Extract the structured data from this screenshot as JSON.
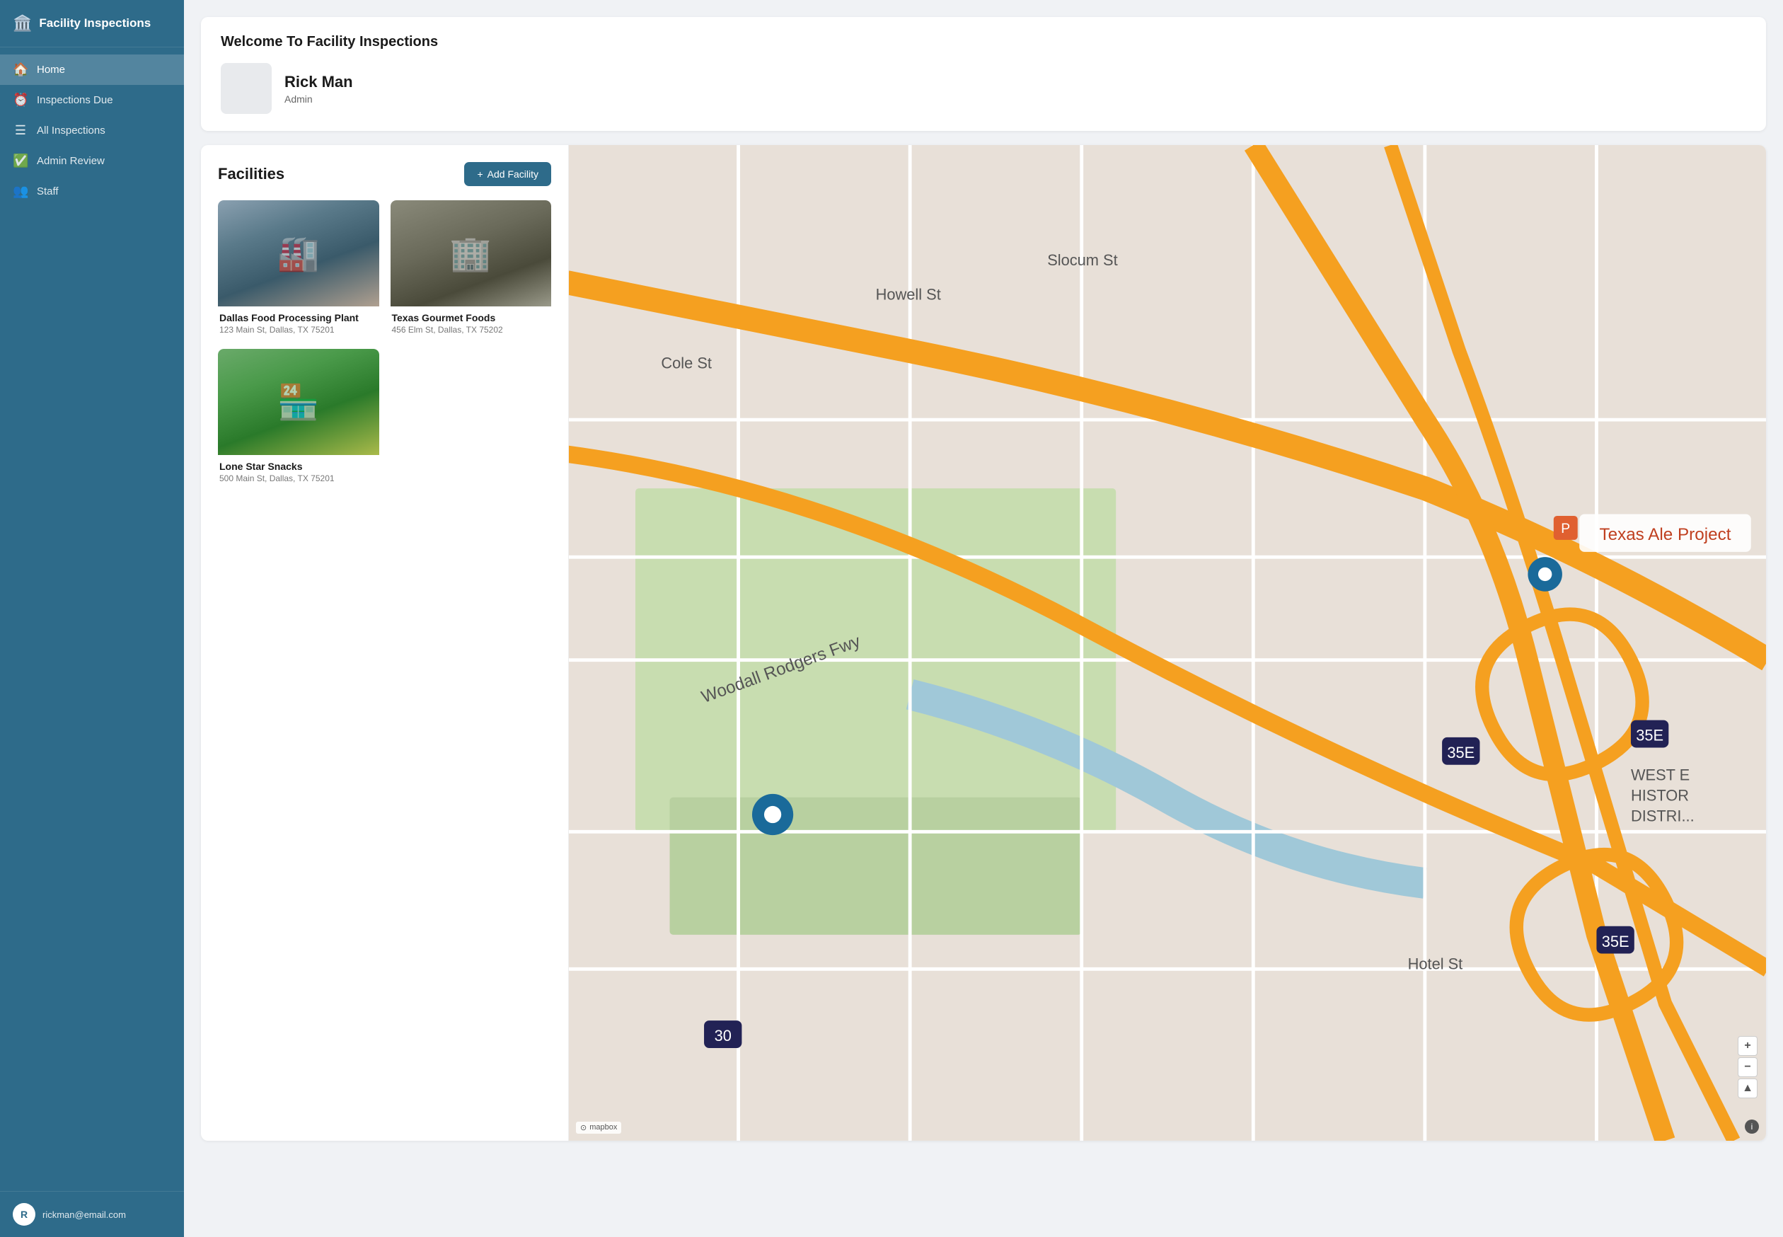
{
  "app": {
    "title": "Facility Inspections",
    "title_icon": "🏛️"
  },
  "sidebar": {
    "nav_items": [
      {
        "id": "home",
        "label": "Home",
        "icon": "home",
        "active": true
      },
      {
        "id": "inspections-due",
        "label": "Inspections Due",
        "icon": "clock",
        "active": false
      },
      {
        "id": "all-inspections",
        "label": "All Inspections",
        "icon": "list",
        "active": false
      },
      {
        "id": "admin-review",
        "label": "Admin Review",
        "icon": "check-circle",
        "active": false
      },
      {
        "id": "staff",
        "label": "Staff",
        "icon": "users",
        "active": false
      }
    ],
    "user": {
      "initial": "R",
      "email": "rickman@email.com"
    }
  },
  "welcome": {
    "title": "Welcome To Facility Inspections",
    "user_name": "Rick Man",
    "user_role": "Admin"
  },
  "facilities": {
    "section_title": "Facilities",
    "add_button_label": "Add Facility",
    "add_button_icon": "+",
    "items": [
      {
        "id": "dallas-food",
        "name": "Dallas Food Processing Plant",
        "address": "123 Main St, Dallas, TX 75201",
        "img_type": "dallas"
      },
      {
        "id": "texas-gourmet",
        "name": "Texas Gourmet Foods",
        "address": "456 Elm St, Dallas, TX 75202",
        "img_type": "texas"
      },
      {
        "id": "lone-star",
        "name": "Lone Star Snacks",
        "address": "500 Main St, Dallas, TX 75201",
        "img_type": "lone"
      }
    ]
  },
  "map": {
    "zoom_in_label": "+",
    "zoom_out_label": "−",
    "north_label": "▲",
    "logo_text": "mapbox",
    "info_label": "i"
  }
}
